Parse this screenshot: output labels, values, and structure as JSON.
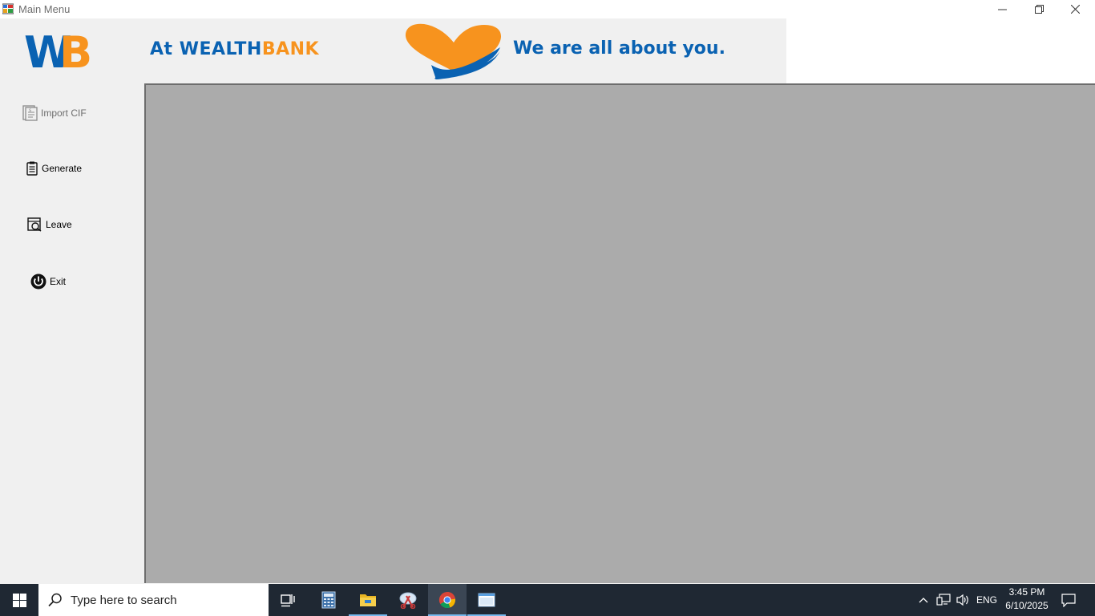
{
  "window": {
    "title": "Main Menu",
    "controls": [
      "minimize-icon",
      "restore-icon",
      "close-icon"
    ]
  },
  "banner": {
    "logo": "WB",
    "text_at": "At",
    "text_wealth": "WEALTH",
    "text_bank": "BANK",
    "tagline": "We are all about you.",
    "colors": {
      "blue": "#0a62b2",
      "orange": "#f7931e"
    }
  },
  "sidebar": {
    "items": [
      {
        "label": "Import CIF",
        "icon": "import-document-icon",
        "enabled": false
      },
      {
        "label": "Generate",
        "icon": "clipboard-list-icon",
        "enabled": true
      },
      {
        "label": "Leave",
        "icon": "leave-search-icon",
        "enabled": true
      },
      {
        "label": "Exit",
        "icon": "power-icon",
        "enabled": true
      }
    ]
  },
  "main": {
    "background": "#ababab"
  },
  "taskbar": {
    "search_placeholder": "Type here to search",
    "apps": [
      "task-view-icon",
      "calculator-icon",
      "file-explorer-icon",
      "snipping-tool-icon",
      "chrome-icon",
      "window-app-icon"
    ],
    "tray": {
      "language": "ENG",
      "time": "3:45 PM",
      "date": "6/10/2025"
    }
  }
}
